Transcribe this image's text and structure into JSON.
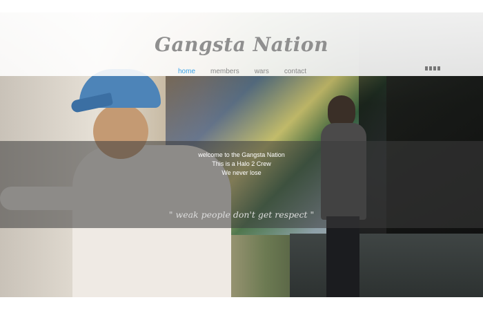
{
  "site": {
    "title": "Gangsta Nation"
  },
  "nav": {
    "items": [
      {
        "label": "home",
        "active": true
      },
      {
        "label": "members",
        "active": false
      },
      {
        "label": "wars",
        "active": false
      },
      {
        "label": "contact",
        "active": false
      }
    ],
    "accent_color": "#3aa3e8"
  },
  "hero": {
    "line1": "welcome to the Gangsta Nation",
    "line2": "This is a Halo 2 Crew",
    "line3": "We never lose",
    "quote": "\" weak people don't get respect \""
  },
  "icons": {
    "menu_dots": "menu-dots-icon"
  }
}
